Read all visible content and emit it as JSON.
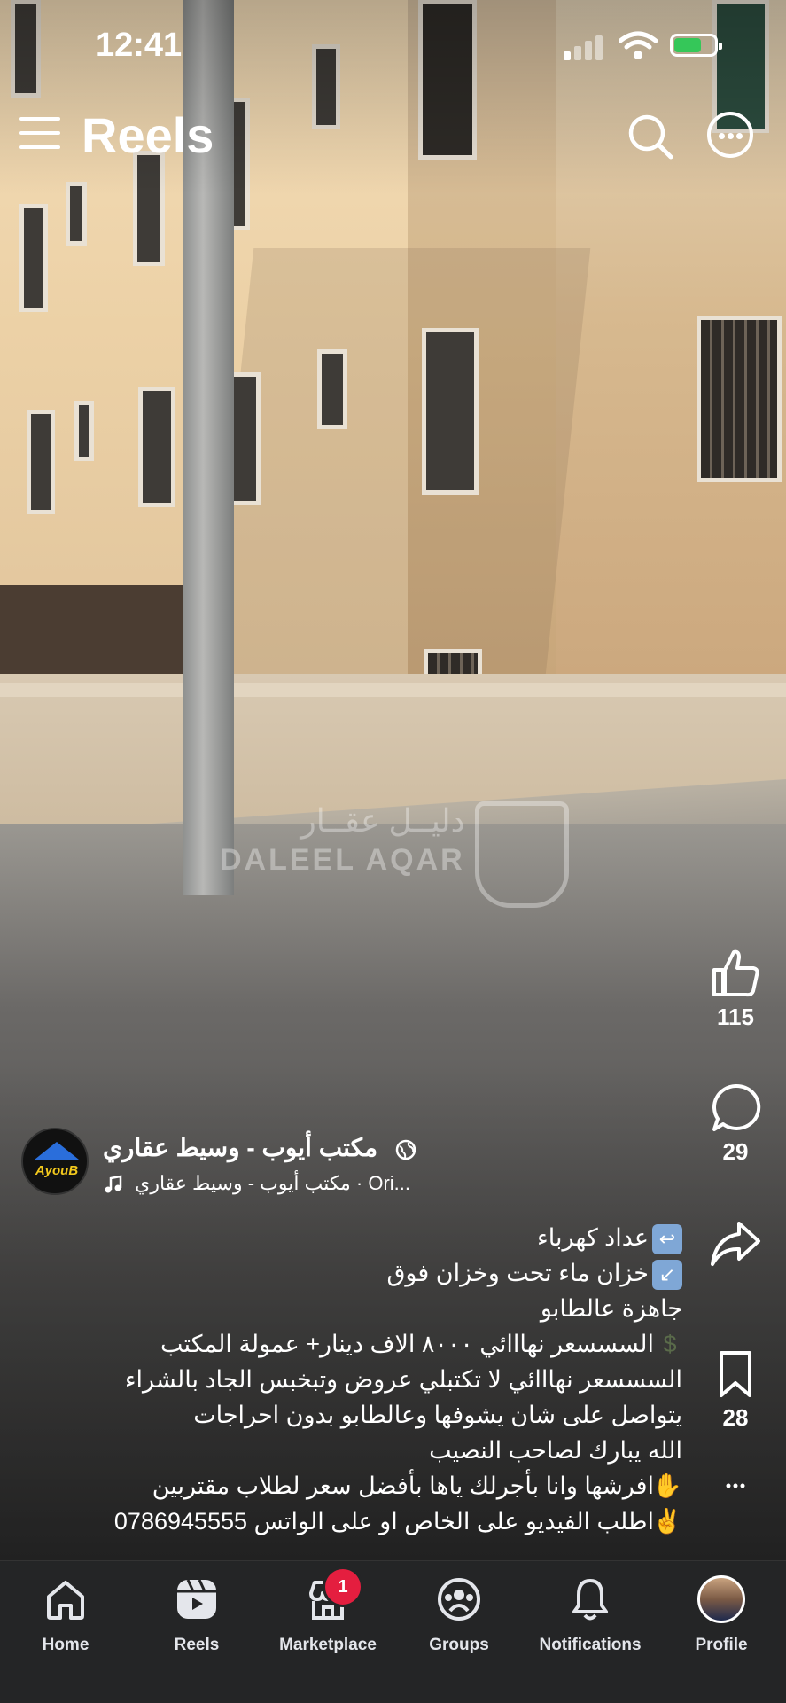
{
  "status_bar": {
    "time": "12:41"
  },
  "header": {
    "title": "Reels"
  },
  "watermark": {
    "arabic": "دليــل عقــار",
    "english": "DALEEL AQAR"
  },
  "reel": {
    "likes": "115",
    "comments": "29",
    "saves": "28",
    "author": {
      "name": "مكتب أيوب - وسيط عقاري",
      "avatar_text": "AyouB",
      "audio": "مكتب أيوب - وسيط عقاري · Ori..."
    },
    "caption": [
      "عداد كهرباء",
      "خزان ماء تحت وخزان فوق",
      "جاهزة عالطابو",
      "السسسعر نهااائي ٨٠٠٠ الاف دينار+ عمولة المكتب",
      "السسسعر نهااائي لا تكتبلي عروض وتبخبس  الجاد بالشراء",
      "يتواصل على شان يشوفها وعالطابو  بدون احراجات",
      "الله يبارك لصاحب النصيب",
      "افرشها وانا بأجرلك ياها بأفضل سعر لطلاب مقتربين",
      "اطلب الفيديو على الخاص او على الواتس 0786945555"
    ]
  },
  "nav": {
    "home": "Home",
    "reels": "Reels",
    "marketplace": "Marketplace",
    "marketplace_badge": "1",
    "groups": "Groups",
    "notifications": "Notifications",
    "profile": "Profile"
  },
  "colors": {
    "nav_bg": "#242526",
    "badge": "#e41e3f",
    "battery": "#35c759"
  }
}
